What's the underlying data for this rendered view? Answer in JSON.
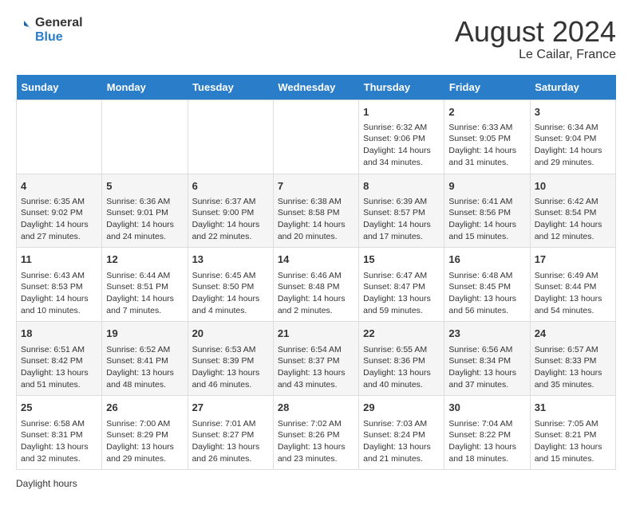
{
  "logo": {
    "general": "General",
    "blue": "Blue"
  },
  "title": "August 2024",
  "subtitle": "Le Cailar, France",
  "days_of_week": [
    "Sunday",
    "Monday",
    "Tuesday",
    "Wednesday",
    "Thursday",
    "Friday",
    "Saturday"
  ],
  "weeks": [
    [
      {
        "day": "",
        "info": ""
      },
      {
        "day": "",
        "info": ""
      },
      {
        "day": "",
        "info": ""
      },
      {
        "day": "",
        "info": ""
      },
      {
        "day": "1",
        "info": "Sunrise: 6:32 AM\nSunset: 9:06 PM\nDaylight: 14 hours and 34 minutes."
      },
      {
        "day": "2",
        "info": "Sunrise: 6:33 AM\nSunset: 9:05 PM\nDaylight: 14 hours and 31 minutes."
      },
      {
        "day": "3",
        "info": "Sunrise: 6:34 AM\nSunset: 9:04 PM\nDaylight: 14 hours and 29 minutes."
      }
    ],
    [
      {
        "day": "4",
        "info": "Sunrise: 6:35 AM\nSunset: 9:02 PM\nDaylight: 14 hours and 27 minutes."
      },
      {
        "day": "5",
        "info": "Sunrise: 6:36 AM\nSunset: 9:01 PM\nDaylight: 14 hours and 24 minutes."
      },
      {
        "day": "6",
        "info": "Sunrise: 6:37 AM\nSunset: 9:00 PM\nDaylight: 14 hours and 22 minutes."
      },
      {
        "day": "7",
        "info": "Sunrise: 6:38 AM\nSunset: 8:58 PM\nDaylight: 14 hours and 20 minutes."
      },
      {
        "day": "8",
        "info": "Sunrise: 6:39 AM\nSunset: 8:57 PM\nDaylight: 14 hours and 17 minutes."
      },
      {
        "day": "9",
        "info": "Sunrise: 6:41 AM\nSunset: 8:56 PM\nDaylight: 14 hours and 15 minutes."
      },
      {
        "day": "10",
        "info": "Sunrise: 6:42 AM\nSunset: 8:54 PM\nDaylight: 14 hours and 12 minutes."
      }
    ],
    [
      {
        "day": "11",
        "info": "Sunrise: 6:43 AM\nSunset: 8:53 PM\nDaylight: 14 hours and 10 minutes."
      },
      {
        "day": "12",
        "info": "Sunrise: 6:44 AM\nSunset: 8:51 PM\nDaylight: 14 hours and 7 minutes."
      },
      {
        "day": "13",
        "info": "Sunrise: 6:45 AM\nSunset: 8:50 PM\nDaylight: 14 hours and 4 minutes."
      },
      {
        "day": "14",
        "info": "Sunrise: 6:46 AM\nSunset: 8:48 PM\nDaylight: 14 hours and 2 minutes."
      },
      {
        "day": "15",
        "info": "Sunrise: 6:47 AM\nSunset: 8:47 PM\nDaylight: 13 hours and 59 minutes."
      },
      {
        "day": "16",
        "info": "Sunrise: 6:48 AM\nSunset: 8:45 PM\nDaylight: 13 hours and 56 minutes."
      },
      {
        "day": "17",
        "info": "Sunrise: 6:49 AM\nSunset: 8:44 PM\nDaylight: 13 hours and 54 minutes."
      }
    ],
    [
      {
        "day": "18",
        "info": "Sunrise: 6:51 AM\nSunset: 8:42 PM\nDaylight: 13 hours and 51 minutes."
      },
      {
        "day": "19",
        "info": "Sunrise: 6:52 AM\nSunset: 8:41 PM\nDaylight: 13 hours and 48 minutes."
      },
      {
        "day": "20",
        "info": "Sunrise: 6:53 AM\nSunset: 8:39 PM\nDaylight: 13 hours and 46 minutes."
      },
      {
        "day": "21",
        "info": "Sunrise: 6:54 AM\nSunset: 8:37 PM\nDaylight: 13 hours and 43 minutes."
      },
      {
        "day": "22",
        "info": "Sunrise: 6:55 AM\nSunset: 8:36 PM\nDaylight: 13 hours and 40 minutes."
      },
      {
        "day": "23",
        "info": "Sunrise: 6:56 AM\nSunset: 8:34 PM\nDaylight: 13 hours and 37 minutes."
      },
      {
        "day": "24",
        "info": "Sunrise: 6:57 AM\nSunset: 8:33 PM\nDaylight: 13 hours and 35 minutes."
      }
    ],
    [
      {
        "day": "25",
        "info": "Sunrise: 6:58 AM\nSunset: 8:31 PM\nDaylight: 13 hours and 32 minutes."
      },
      {
        "day": "26",
        "info": "Sunrise: 7:00 AM\nSunset: 8:29 PM\nDaylight: 13 hours and 29 minutes."
      },
      {
        "day": "27",
        "info": "Sunrise: 7:01 AM\nSunset: 8:27 PM\nDaylight: 13 hours and 26 minutes."
      },
      {
        "day": "28",
        "info": "Sunrise: 7:02 AM\nSunset: 8:26 PM\nDaylight: 13 hours and 23 minutes."
      },
      {
        "day": "29",
        "info": "Sunrise: 7:03 AM\nSunset: 8:24 PM\nDaylight: 13 hours and 21 minutes."
      },
      {
        "day": "30",
        "info": "Sunrise: 7:04 AM\nSunset: 8:22 PM\nDaylight: 13 hours and 18 minutes."
      },
      {
        "day": "31",
        "info": "Sunrise: 7:05 AM\nSunset: 8:21 PM\nDaylight: 13 hours and 15 minutes."
      }
    ]
  ],
  "footer": "Daylight hours"
}
